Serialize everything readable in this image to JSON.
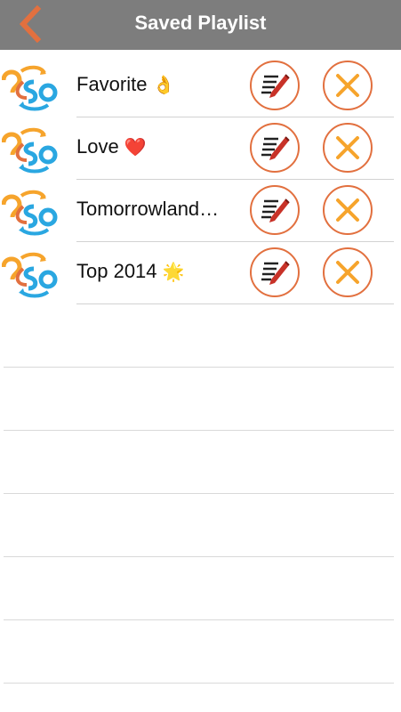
{
  "header": {
    "title": "Saved Playlist",
    "back_icon": "chevron-left-icon"
  },
  "colors": {
    "accent": "#e2703f",
    "header_bg": "#7d7d7d",
    "logo_orange": "#f6a42c",
    "logo_blue": "#2aa7e1"
  },
  "playlists": [
    {
      "name": "Favorite",
      "emoji": "👌"
    },
    {
      "name": "Love",
      "emoji": "❤️"
    },
    {
      "name": "Tomorrowland…",
      "emoji": ""
    },
    {
      "name": "Top 2014",
      "emoji": "🌟"
    }
  ]
}
